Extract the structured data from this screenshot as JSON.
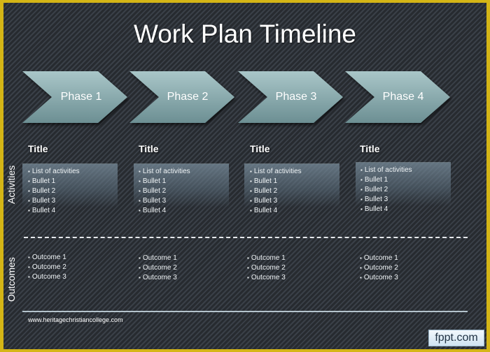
{
  "slide": {
    "title": "Work Plan Timeline",
    "colors": {
      "frame": "#d4b516",
      "background": "#2f343a",
      "chevron_top": "#a7c4c6",
      "chevron_bottom": "#6f9295",
      "text": "#ffffff"
    }
  },
  "phases": [
    {
      "label": "Phase 1"
    },
    {
      "label": "Phase 2"
    },
    {
      "label": "Phase 3"
    },
    {
      "label": "Phase 4"
    }
  ],
  "side_labels": {
    "activities": "Activities",
    "outcomes": "Outcomes"
  },
  "columns": [
    {
      "title": "Title",
      "activities": [
        "List of activities",
        "Bullet 1",
        "Bullet 2",
        "Bullet 3",
        "Bullet 4"
      ],
      "outcomes": [
        "Outcome 1",
        "Outcome 2",
        "Outcome 3"
      ]
    },
    {
      "title": "Title",
      "activities": [
        "List of activities",
        "Bullet 1",
        "Bullet 2",
        "Bullet 3",
        "Bullet 4"
      ],
      "outcomes": [
        "Outcome 1",
        "Outcome 2",
        "Outcome 3"
      ]
    },
    {
      "title": "Title",
      "activities": [
        "List of activities",
        "Bullet 1",
        "Bullet 2",
        "Bullet 3",
        "Bullet 4"
      ],
      "outcomes": [
        "Outcome 1",
        "Outcome 2",
        "Outcome 3"
      ]
    },
    {
      "title": "Title",
      "activities": [
        "List of activities",
        "Bullet 1",
        "Bullet 2",
        "Bullet 3",
        "Bullet 4"
      ],
      "outcomes": [
        "Outcome 1",
        "Outcome 2",
        "Outcome 3"
      ]
    }
  ],
  "footer": {
    "url": "www.heritagechristiancollege.com",
    "logo": "fppt.com"
  }
}
